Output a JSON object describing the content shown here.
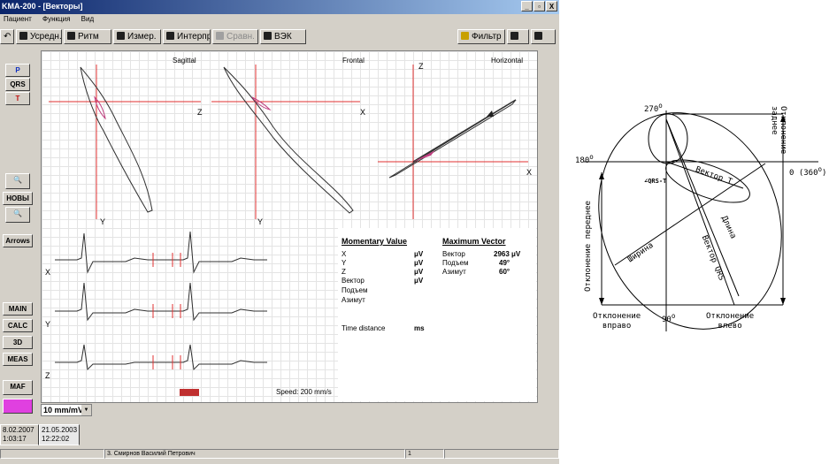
{
  "window": {
    "title": "KMA-200 - [Векторы]",
    "buttons": [
      "_",
      "▫",
      "X"
    ]
  },
  "menu": [
    "Пациент",
    "Функция",
    "Вид"
  ],
  "toolbar": {
    "items": [
      "Усредн.",
      "Ритм",
      "Измер.",
      "Интерпр",
      "Сравн.",
      "ВЭК"
    ],
    "filter": "Фильтр"
  },
  "leftpanel": {
    "items": [
      "P",
      "QRS",
      "T",
      "",
      "НОВЫ",
      "",
      "Arrows",
      "MAIN",
      "CALC",
      "3D",
      "MEAS",
      "MAF",
      ""
    ]
  },
  "plots": {
    "sagittal": {
      "title": "Sagittal",
      "h_axis": "Z",
      "v_axis": "Y"
    },
    "frontal": {
      "title": "Frontal",
      "h_axis": "X",
      "v_axis": "Y"
    },
    "horizontal": {
      "title": "Horizontal",
      "h_axis": "X",
      "v_axis": "Z"
    }
  },
  "ecg": {
    "leads": [
      "X",
      "Y",
      "Z"
    ],
    "speed": "Speed: 200 mm/s"
  },
  "momentary": {
    "title": "Momentary Value",
    "rows": [
      {
        "label": "X",
        "unit": "μV"
      },
      {
        "label": "Y",
        "unit": "μV"
      },
      {
        "label": "Z",
        "unit": "μV"
      },
      {
        "label": "Вектор",
        "unit": "μV"
      },
      {
        "label": "Подъем",
        "unit": ""
      },
      {
        "label": "Азимут",
        "unit": ""
      }
    ],
    "time_label": "Time distance",
    "time_unit": "ms"
  },
  "maximum": {
    "title": "Maximum Vector",
    "rows": [
      {
        "label": "Вектор",
        "value": "2963 μV"
      },
      {
        "label": "Подъем",
        "value": "49°"
      },
      {
        "label": "Азимут",
        "value": "60°"
      }
    ]
  },
  "scale": "10 mm/mV",
  "tabs": [
    {
      "line1": "8.02.2007",
      "line2": "1:03:17"
    },
    {
      "line1": "21.05.2003",
      "line2": "12:22:02"
    }
  ],
  "status": {
    "patient": "3. Смирнов Василий Петрович",
    "page": "1"
  },
  "diagram": {
    "angle_top": "270",
    "angle_left": "180",
    "angle_right": "0 (360",
    "angle_bottom": "90",
    "degree_mark": "o",
    "qrs_t": "∠QRS-T",
    "vector_t": "Вектор Т",
    "length": "Длина",
    "vector_qrs": "Вектор QRS",
    "width": "Ширина",
    "posterior": [
      "Отклонение",
      "заднее"
    ],
    "anterior": "Отклонение переднее",
    "right_dev": [
      "Отклонение",
      "вправо"
    ],
    "left_dev": [
      "Отклонение",
      "влево"
    ]
  },
  "colors": {
    "titlebar": "#0a246a",
    "axis": "#e03030",
    "loop": "#303030",
    "panel": "#d4d0c8"
  }
}
